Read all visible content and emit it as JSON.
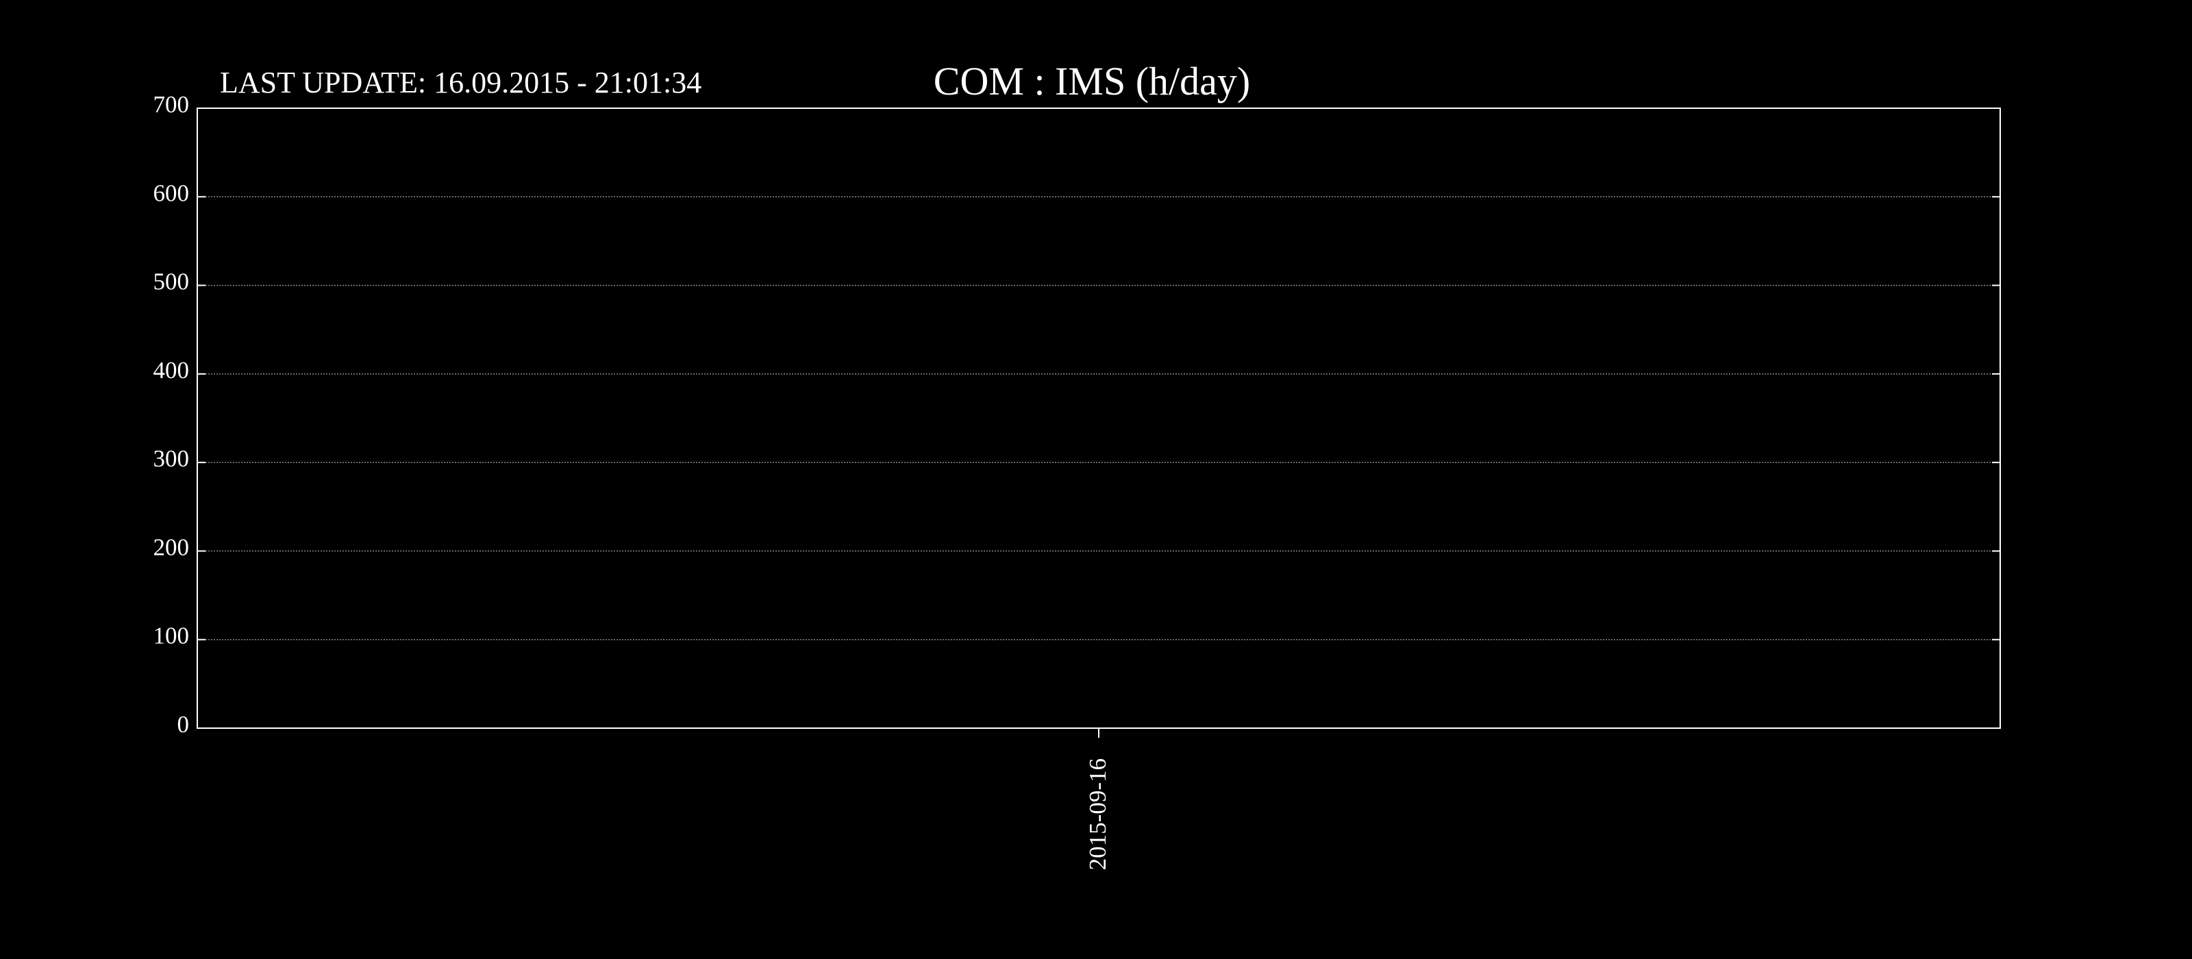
{
  "last_update": "LAST UPDATE: 16.09.2015 - 21:01:34",
  "chart_data": {
    "type": "bar",
    "title": "COM : IMS (h/day)",
    "xlabel": "",
    "ylabel": "",
    "categories": [
      "2015-09-16"
    ],
    "values": [
      0
    ],
    "ylim": [
      0,
      700
    ],
    "yticks": [
      0,
      100,
      200,
      300,
      400,
      500,
      600,
      700
    ],
    "grid": true,
    "legend": "none"
  },
  "colors": {
    "background": "#000000",
    "axis": "#ffffff",
    "grid": "#8a8a8a",
    "text": "#ffffff",
    "bar": "#ffffff"
  }
}
